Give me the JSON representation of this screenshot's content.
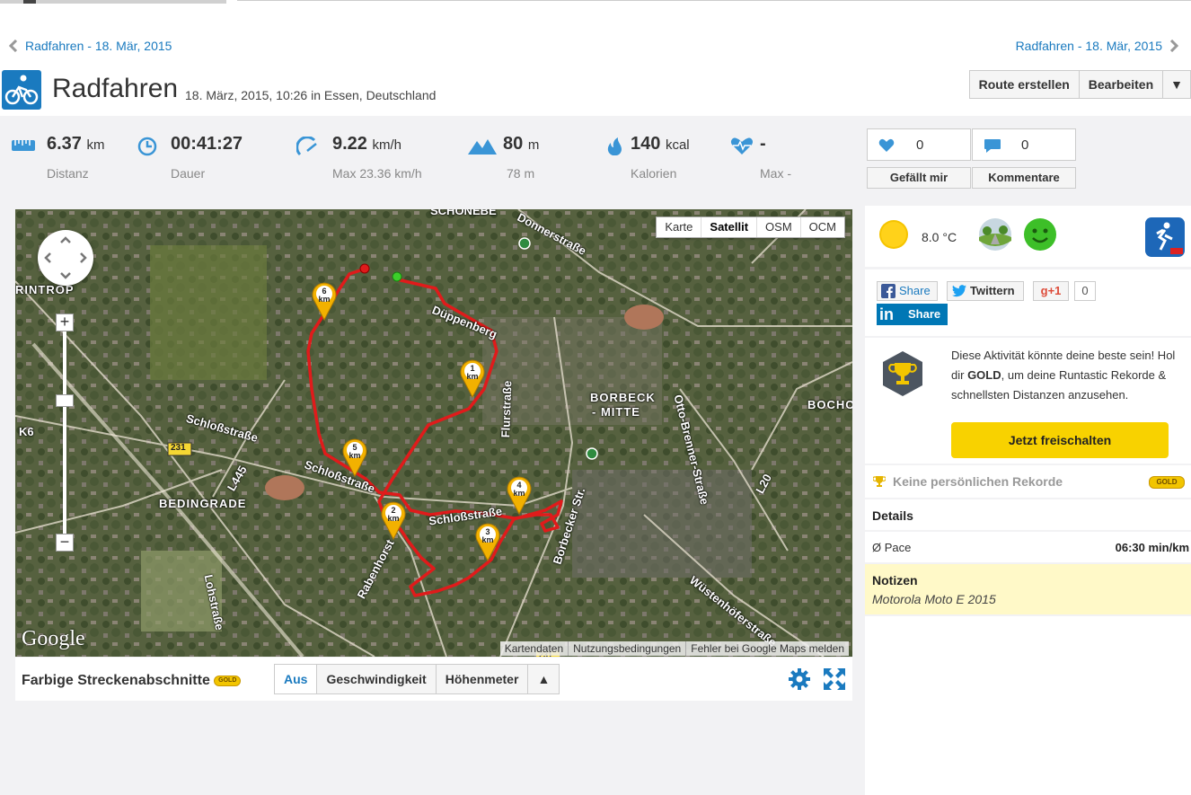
{
  "breadcrumbs": {
    "prev": "Radfahren - 18. Mär, 2015",
    "next": "Radfahren - 18. Mär, 2015"
  },
  "header": {
    "title": "Radfahren",
    "subtitle": "18. März, 2015, 10:26 in Essen, Deutschland",
    "buttons": [
      "Route erstellen",
      "Bearbeiten",
      "▼"
    ]
  },
  "stats": {
    "distance": {
      "value": "6.37",
      "unit": "km",
      "label": "Distanz"
    },
    "duration": {
      "value": "00:41:27",
      "label": "Dauer"
    },
    "speed": {
      "value": "9.22",
      "unit": "km/h",
      "label": "Max 23.36 km/h"
    },
    "elevation": {
      "value": "80",
      "unit": "m",
      "label": "78 m"
    },
    "calories": {
      "value": "140",
      "unit": "kcal",
      "label": "Kalorien"
    },
    "heartrate": {
      "value": "-",
      "label": "Max -"
    }
  },
  "social": {
    "likes": {
      "count": "0",
      "label": "Gefällt mir"
    },
    "comments": {
      "count": "0",
      "label": "Kommentare"
    }
  },
  "map": {
    "types": [
      "Karte",
      "Satellit",
      "OSM",
      "OCM"
    ],
    "active_type": "Satellit",
    "logo": "Google",
    "footer": [
      "Kartendaten",
      "Nutzungsbedingungen",
      "Fehler bei Google Maps melden"
    ],
    "labels": {
      "schlossstrasse1": "Schloßstraße",
      "schlossstrasse2": "Schloßstraße",
      "schlossstrasse3": "Schloßstraße",
      "duppenberg": "Düppenberg",
      "flurstrasse": "Flurstraße",
      "donnerstrasse": "Donnerstraße",
      "borbeck": "BORBECK",
      "mitte": "- MITTE",
      "bedingrade": "BEDINGRADE",
      "bocho": "BOCHO",
      "rintrop": "RINTROP",
      "rabenhorst": "Rabenhorst",
      "lohstrasse": "Lohstraße",
      "otto": "Otto-Brenner-Straße",
      "borbecker": "Borbecker Str.",
      "wustenhofer": "Wüstenhöferstraße",
      "k6": "K6",
      "l445": "L445",
      "l20": "L20",
      "r231": "231",
      "r231b": "231",
      "schonebe": "SCHÖNEBE"
    },
    "km_markers": [
      "1",
      "2",
      "3",
      "4",
      "5",
      "6"
    ],
    "km_unit": "km",
    "zoom_in": "+",
    "zoom_out": "−"
  },
  "segments": {
    "title": "Farbige Streckenabschnitte",
    "badge": "GOLD",
    "options": [
      "Aus",
      "Geschwindigkeit",
      "Höhenmeter",
      "▲"
    ],
    "active": "Aus"
  },
  "weather": {
    "temperature": "8.0 °C"
  },
  "share": {
    "facebook": "Share",
    "twitter": "Twittern",
    "gplus": "+1",
    "gplus_count": "0",
    "linkedin_logo": "in",
    "linkedin": "Share"
  },
  "gold_promo": {
    "text_1": "Diese Aktivität könnte deine beste sein! Hol dir ",
    "text_bold": "GOLD",
    "text_2": ", um deine Runtastic Rekorde & schnellsten Distanzen anzusehen.",
    "cta": "Jetzt freischalten"
  },
  "records": {
    "label": "Keine persönlichen Rekorde",
    "badge": "GOLD"
  },
  "details": {
    "heading": "Details",
    "pace_label": "Ø Pace",
    "pace_value": "06:30 min/km"
  },
  "notes": {
    "heading": "Notizen",
    "text": "Motorola Moto E 2015"
  },
  "colors": {
    "brand_blue": "#1a7abf",
    "route_red": "#e01b1b",
    "gold": "#f8d200",
    "panel_bg": "#f2f2f4"
  }
}
